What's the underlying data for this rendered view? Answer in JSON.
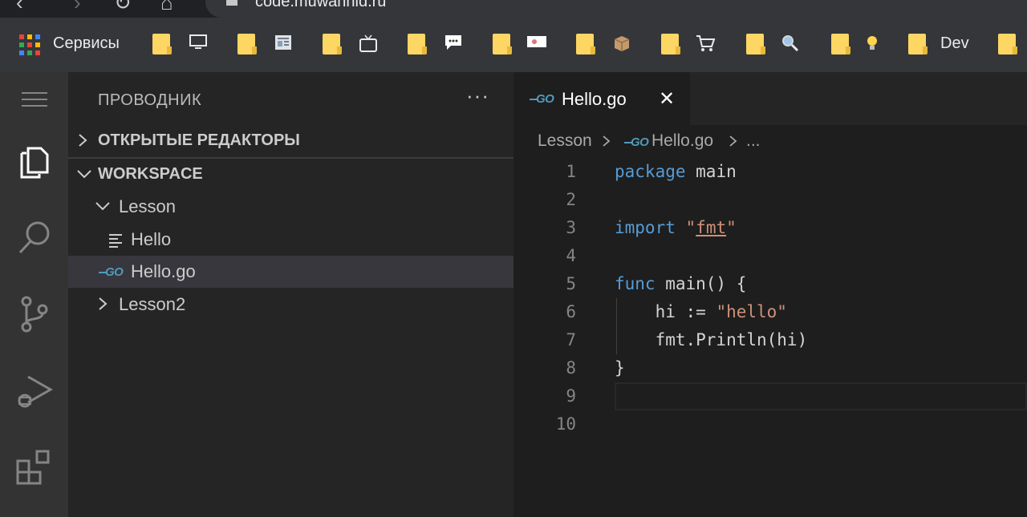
{
  "browser": {
    "url": "code.muwanhid.ru"
  },
  "bookmarks": {
    "apps_label": "Сервисы",
    "dev_label": "Dev",
    "folder_color": "#fdd663",
    "items": [
      {
        "icon": "monitor-icon"
      },
      {
        "icon": "newspaper-icon"
      },
      {
        "icon": "tv-icon"
      },
      {
        "icon": "chat-icon"
      },
      {
        "icon": "mail-icon"
      },
      {
        "icon": "package-icon"
      },
      {
        "icon": "cart-icon"
      },
      {
        "icon": "magnifier-icon"
      },
      {
        "icon": "lightbulb-icon"
      }
    ]
  },
  "activity_bar": {
    "items": [
      "menu-icon",
      "explorer-icon",
      "search-icon",
      "source-control-icon",
      "run-debug-icon",
      "extensions-icon"
    ]
  },
  "sidebar": {
    "title": "ПРОВОДНИК",
    "more": "···",
    "open_editors_label": "ОТКРЫТЫЕ РЕДАКТОРЫ",
    "workspace_label": "WORKSPACE",
    "tree": [
      {
        "label": "Lesson",
        "type": "folder",
        "expanded": true
      },
      {
        "label": "Hello",
        "type": "file"
      },
      {
        "label": "Hello.go",
        "type": "go-file",
        "selected": true
      },
      {
        "label": "Lesson2",
        "type": "folder",
        "expanded": false
      }
    ]
  },
  "editor": {
    "tab": {
      "label": "Hello.go",
      "close": "✕"
    },
    "go_icon_text": "GO",
    "breadcrumb": {
      "folder": "Lesson",
      "file": "Hello.go",
      "more": "..."
    },
    "line_numbers": [
      "1",
      "2",
      "3",
      "4",
      "5",
      "6",
      "7",
      "8",
      "9",
      "10"
    ],
    "code": {
      "l1_kw": "package",
      "l1_rest": " main",
      "l3_kw": "import",
      "l3_q1": "\"",
      "l3_str": "fmt",
      "l3_q2": "\"",
      "l5_kw": "func",
      "l5_rest": " main() {",
      "l6_plain": "    hi := ",
      "l6_str": "\"hello\"",
      "l7": "    fmt.Println(hi)",
      "l8": "}"
    }
  },
  "colors": {
    "keyword": "#569cd6",
    "string": "#ce9178",
    "go_icon": "#519aba"
  }
}
